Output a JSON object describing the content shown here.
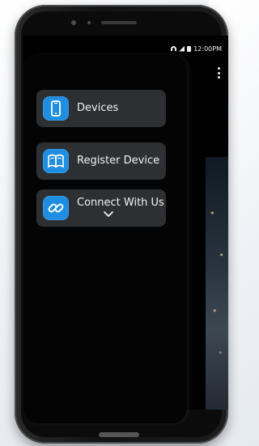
{
  "status_bar": {
    "time": "12:00PM"
  },
  "menu": {
    "items": [
      {
        "label": "Devices",
        "icon": "phone-device-icon"
      },
      {
        "label": "Register Device",
        "icon": "book-icon"
      },
      {
        "label": "Connect With Us",
        "icon": "link-icon"
      }
    ]
  },
  "colors": {
    "accent": "#1f8de0",
    "menu_bg": "#2d3033",
    "drawer_bg": "#040404"
  }
}
